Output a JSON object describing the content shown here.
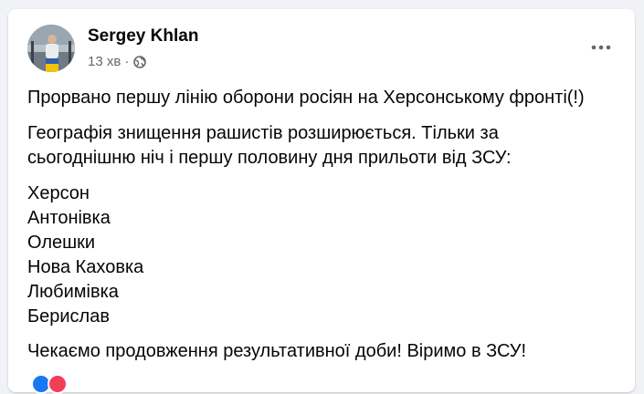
{
  "post": {
    "author": "Sergey Khlan",
    "time": "13 хв",
    "separator": "·",
    "privacy_icon": "globe-icon",
    "more_icon": "more-horizontal-icon",
    "paragraphs": {
      "p1": "Прорвано першу лінію оборони росіян на Херсонському фронті(!)",
      "p2_line1": "Географія знищення рашистів розширюється. Тільки за",
      "p2_line2": "сьогоднішню ніч і першу половину дня прильоти від ЗСУ:",
      "p3": "Чекаємо продовження результативної доби! Віримо в ЗСУ!"
    },
    "cities": [
      "Херсон",
      "Антонівка",
      "Олешки",
      "Нова Каховка",
      "Любимівка",
      "Берислав"
    ]
  },
  "colors": {
    "background": "#f0f2f5",
    "card": "#ffffff",
    "text_primary": "#050505",
    "text_secondary": "#65676b",
    "like_blue": "#1877f2",
    "love_red": "#f33e58"
  }
}
